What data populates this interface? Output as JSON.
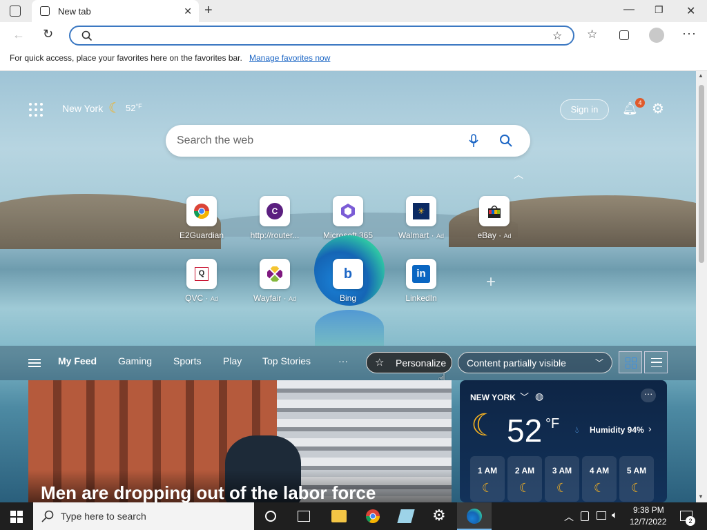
{
  "browser": {
    "tab_title": "New tab",
    "favorites_prompt": "For quick access, place your favorites here on the favorites bar.",
    "manage_favorites": "Manage favorites now"
  },
  "ntp": {
    "location": "New York",
    "temperature": "52",
    "temp_unit": "°F",
    "sign_in": "Sign in",
    "notification_count": "4",
    "search_placeholder": "Search the web",
    "tiles": [
      {
        "label": "E2Guardian",
        "ad": "",
        "icon": "chrome-icon"
      },
      {
        "label": "http://router...",
        "ad": "",
        "icon": "c-icon"
      },
      {
        "label": "Microsoft 365",
        "ad": "",
        "icon": "microsoft365-icon"
      },
      {
        "label": "Walmart",
        "ad": "Ad",
        "icon": "walmart-icon"
      },
      {
        "label": "eBay",
        "ad": "Ad",
        "icon": "ebay-icon"
      },
      {
        "label": "QVC",
        "ad": "Ad",
        "icon": "qvc-icon"
      },
      {
        "label": "Wayfair",
        "ad": "Ad",
        "icon": "wayfair-icon"
      },
      {
        "label": "Bing",
        "ad": "",
        "icon": "bing-icon"
      },
      {
        "label": "LinkedIn",
        "ad": "",
        "icon": "linkedin-icon"
      }
    ]
  },
  "feed": {
    "tabs": [
      "My Feed",
      "Gaming",
      "Sports",
      "Play",
      "Top Stories"
    ],
    "more": "···",
    "personalize": "Personalize",
    "content_visibility": "Content partially visible",
    "headline": "Men are dropping out of the labor force"
  },
  "weather": {
    "city": "NEW YORK",
    "temperature": "52",
    "unit": "°F",
    "humidity": "Humidity 94%",
    "hours": [
      "1 AM",
      "2 AM",
      "3 AM",
      "4 AM",
      "5 AM"
    ]
  },
  "taskbar": {
    "search_placeholder": "Type here to search",
    "time": "9:38 PM",
    "date": "12/7/2022",
    "notification_count": "2"
  },
  "colors": {
    "accent": "#1c66c5",
    "taskbar": "#1f1f1f"
  }
}
